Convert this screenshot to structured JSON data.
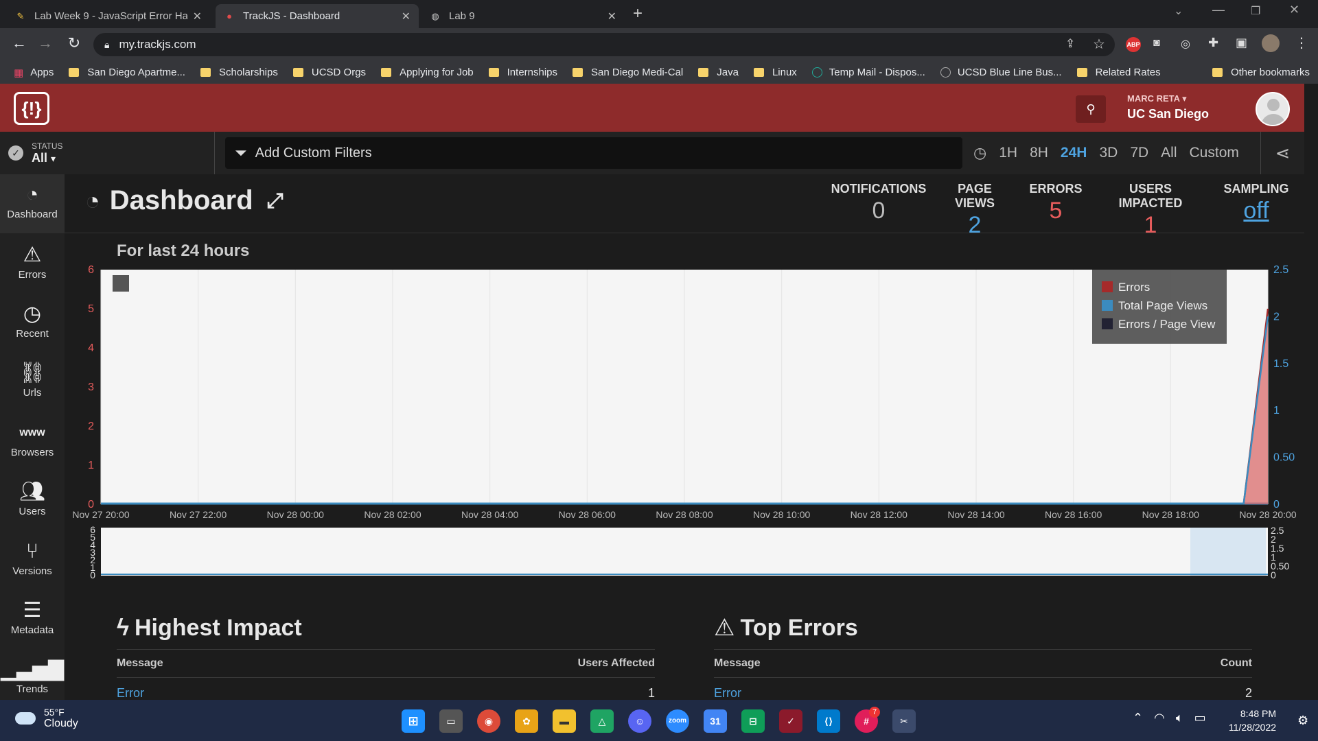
{
  "browser": {
    "tabs": [
      {
        "title": "Lab Week 9 - JavaScript Error Ha",
        "icon": "pen-icon",
        "active": false
      },
      {
        "title": "TrackJS - Dashboard",
        "icon": "trackjs-icon",
        "active": true
      },
      {
        "title": "Lab 9",
        "icon": "globe-icon",
        "active": false
      }
    ],
    "url": "my.trackjs.com",
    "bookmarks": [
      "Apps",
      "San Diego Apartme...",
      "Scholarships",
      "UCSD Orgs",
      "Applying for Job",
      "Internships",
      "San Diego Medi-Cal",
      "Java",
      "Linux",
      "Temp Mail - Dispos...",
      "UCSD Blue Line Bus...",
      "Related Rates"
    ],
    "other_bookmarks": "Other bookmarks"
  },
  "header": {
    "logo": "{!}",
    "user": "MARC RETA",
    "org": "UC San Diego"
  },
  "filters": {
    "status_label": "STATUS",
    "status_value": "All",
    "add_filters": "Add Custom Filters",
    "ranges": [
      "1H",
      "8H",
      "24H",
      "3D",
      "7D",
      "All",
      "Custom"
    ],
    "active_range": "24H"
  },
  "sidebar": {
    "items": [
      {
        "label": "Dashboard",
        "icon": "gauge-icon"
      },
      {
        "label": "Errors",
        "icon": "warning-icon"
      },
      {
        "label": "Recent",
        "icon": "clock-icon"
      },
      {
        "label": "Urls",
        "icon": "link-icon"
      },
      {
        "label": "Browsers",
        "icon": "www-icon"
      },
      {
        "label": "Users",
        "icon": "users-icon"
      },
      {
        "label": "Versions",
        "icon": "branch-icon"
      },
      {
        "label": "Metadata",
        "icon": "database-icon"
      },
      {
        "label": "Trends",
        "icon": "bars-icon"
      }
    ]
  },
  "dashboard": {
    "title": "Dashboard",
    "stats": [
      {
        "label": "NOTIFICATIONS",
        "value": "0",
        "color": "#bbbbbb"
      },
      {
        "label": "PAGE VIEWS",
        "value": "2",
        "color": "#4ea3e0"
      },
      {
        "label": "ERRORS",
        "value": "5",
        "color": "#e65c5c"
      },
      {
        "label": "USERS IMPACTED",
        "value": "1",
        "color": "#e65c5c"
      },
      {
        "label": "SAMPLING",
        "value": "off",
        "color": "#4ea3e0"
      }
    ],
    "period": "For last 24 hours"
  },
  "chart_data": {
    "type": "area",
    "x": [
      "Nov 27 20:00",
      "Nov 27 22:00",
      "Nov 28 00:00",
      "Nov 28 02:00",
      "Nov 28 04:00",
      "Nov 28 06:00",
      "Nov 28 08:00",
      "Nov 28 10:00",
      "Nov 28 12:00",
      "Nov 28 14:00",
      "Nov 28 16:00",
      "Nov 28 18:00",
      "Nov 28 20:00"
    ],
    "y_left_ticks": [
      "0",
      "1",
      "2",
      "3",
      "4",
      "5",
      "6"
    ],
    "y_right_ticks": [
      "0",
      "0.50",
      "1",
      "1.5",
      "2",
      "2.5"
    ],
    "y_left_range": [
      0,
      6
    ],
    "y_right_range": [
      0,
      2.5
    ],
    "legend": "top-right",
    "series": [
      {
        "name": "Errors",
        "color": "#a52a2a",
        "axis": "left",
        "points": [
          [
            "Nov 28 19:30",
            0
          ],
          [
            "Nov 28 20:00",
            5
          ]
        ]
      },
      {
        "name": "Total Page Views",
        "color": "#3b8bbf",
        "axis": "right",
        "points": [
          [
            "Nov 28 19:30",
            0
          ],
          [
            "Nov 28 20:00",
            2
          ]
        ]
      },
      {
        "name": "Errors / Page View",
        "color": "#222233",
        "axis": "right",
        "points": []
      }
    ],
    "navigator_y_left_ticks": [
      "0",
      "1",
      "2",
      "3",
      "4",
      "5",
      "6"
    ],
    "navigator_y_right_ticks": [
      "0",
      "0.50",
      "1",
      "1.5",
      "2",
      "2.5"
    ]
  },
  "highest_impact": {
    "title": "Highest Impact",
    "col1": "Message",
    "col2": "Users Affected",
    "rows": [
      {
        "message": "Error",
        "value": "1"
      }
    ]
  },
  "top_errors": {
    "title": "Top Errors",
    "col1": "Message",
    "col2": "Count",
    "rows": [
      {
        "message": "Error",
        "value": "2"
      }
    ]
  },
  "taskbar": {
    "temp": "55°F",
    "weather": "Cloudy",
    "time": "8:48 PM",
    "date": "11/28/2022",
    "badge": "7"
  }
}
